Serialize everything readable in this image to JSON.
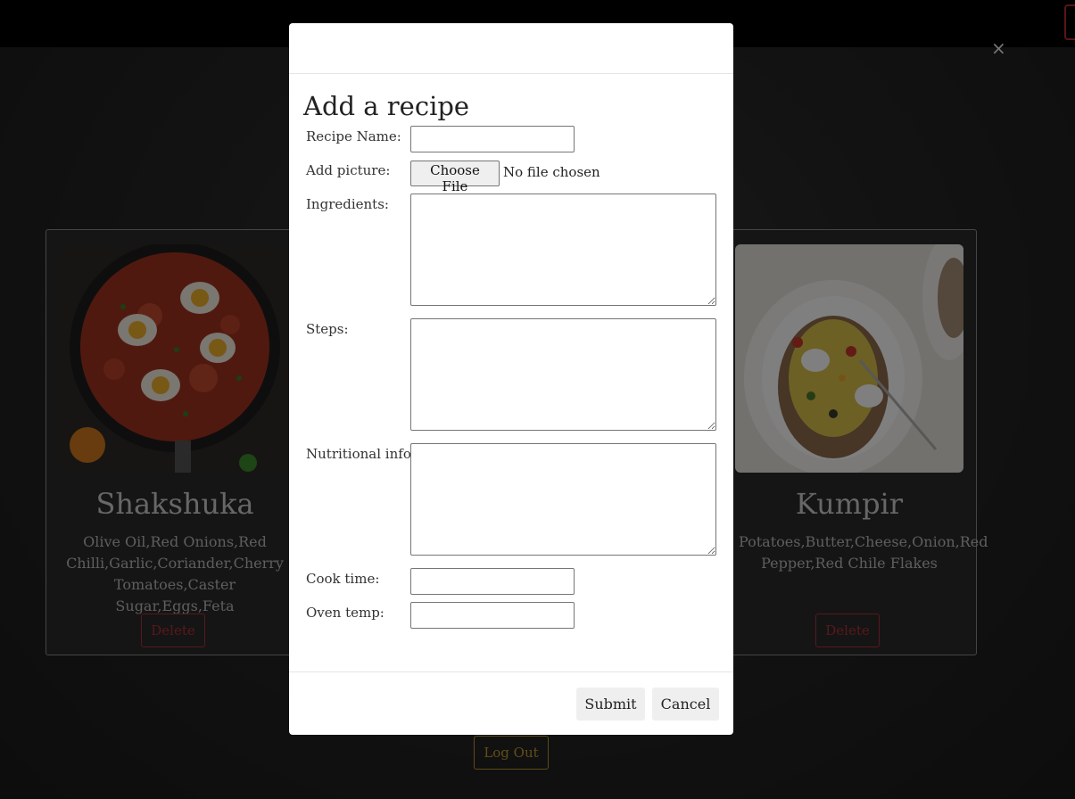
{
  "recipes": [
    {
      "title": "Shakshuka",
      "ingredients": "Olive Oil,Red Onions,Red Chilli,Garlic,Coriander,Cherry Tomatoes,Caster Sugar,Eggs,Feta",
      "delete_label": "Delete"
    },
    {
      "title": "Kumpir",
      "ingredients": "Potatoes,Butter,Cheese,Onion,Red Pepper,Red Chile Flakes",
      "delete_label": "Delete"
    }
  ],
  "logout_label": "Log Out",
  "modal": {
    "close": "×",
    "title": "Add a recipe",
    "labels": {
      "name": "Recipe Name:",
      "picture": "Add picture:",
      "ingredients": "Ingredients:",
      "steps": "Steps:",
      "nutrition": "Nutritional info:",
      "cook_time": "Cook time:",
      "oven_temp": "Oven temp:"
    },
    "file_button": "Choose File",
    "file_status": "No file chosen",
    "submit": "Submit",
    "cancel": "Cancel"
  },
  "colors": {
    "delete": "#b2303a",
    "logout": "#c49b2e",
    "topbar": "#000000"
  }
}
